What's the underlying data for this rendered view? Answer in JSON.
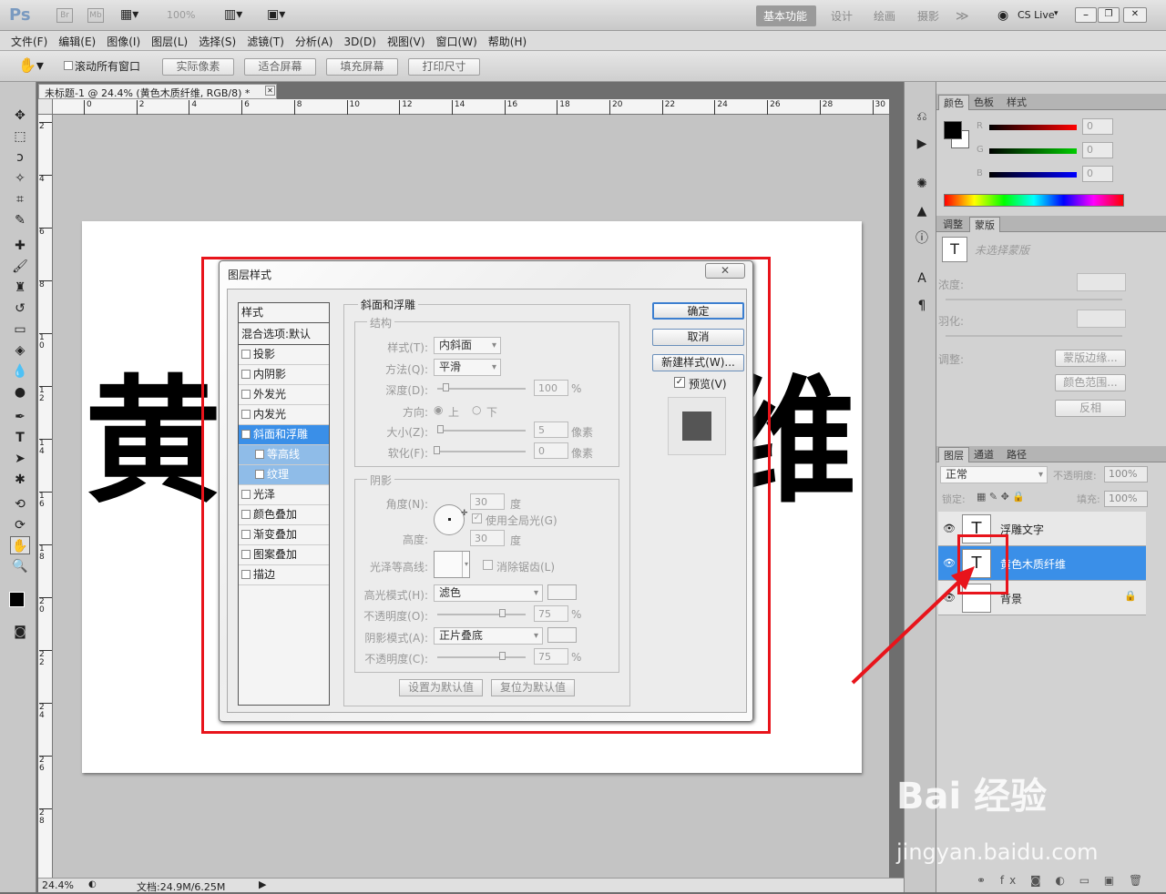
{
  "app": {
    "logo": "Ps",
    "br": "Br",
    "mb": "Mb",
    "zoom": "100%",
    "workspaces": [
      "基本功能",
      "设计",
      "绘画",
      "摄影"
    ],
    "cslive": "CS Live"
  },
  "menu": [
    "文件(F)",
    "编辑(E)",
    "图像(I)",
    "图层(L)",
    "选择(S)",
    "滤镜(T)",
    "分析(A)",
    "3D(D)",
    "视图(V)",
    "窗口(W)",
    "帮助(H)"
  ],
  "options": {
    "scroll_all": "滚动所有窗口",
    "actual_pixels": "实际像素",
    "fit_screen": "适合屏幕",
    "fill_screen": "填充屏幕",
    "print_size": "打印尺寸"
  },
  "document": {
    "tab_title": "未标题-1 @ 24.4% (黄色木质纤维, RGB/8) *",
    "ruler_h": [
      "0",
      "2",
      "4",
      "6",
      "8",
      "10",
      "12",
      "14",
      "16",
      "18",
      "20",
      "22",
      "24",
      "26",
      "28",
      "30"
    ],
    "ruler_v": [
      "2",
      "4",
      "6",
      "8",
      "1\n0",
      "1\n2",
      "1\n4",
      "1\n6",
      "1\n8",
      "2\n0",
      "2\n2",
      "2\n4",
      "2\n6",
      "2\n8"
    ],
    "char_left": "黄",
    "char_right": "维"
  },
  "status": {
    "zoom": "24.4%",
    "doc": "文档:24.9M/6.25M"
  },
  "color_panel": {
    "tabs": [
      "颜色",
      "色板",
      "样式"
    ],
    "r_label": "R",
    "g_label": "G",
    "b_label": "B",
    "r": "0",
    "g": "0",
    "b": "0"
  },
  "masks_panel": {
    "tabs": [
      "调整",
      "蒙版"
    ],
    "no_mask": "未选择蒙版",
    "density": "浓度:",
    "feather": "羽化:",
    "adjust": "调整:",
    "mask_edge": "蒙版边缘...",
    "color_range": "颜色范围...",
    "invert": "反相"
  },
  "layers_panel": {
    "tabs": [
      "图层",
      "通道",
      "路径"
    ],
    "blend_mode": "正常",
    "opacity_label": "不透明度:",
    "opacity": "100%",
    "lock_label": "锁定:",
    "fill_label": "填充:",
    "fill": "100%",
    "layers": [
      {
        "name": "浮雕文字",
        "thumb": "T"
      },
      {
        "name": "黄色木质纤维",
        "thumb": "T"
      },
      {
        "name": "背景",
        "thumb": ""
      }
    ]
  },
  "dialog": {
    "title": "图层样式",
    "close": "✕",
    "styles_header": "样式",
    "blend_options": "混合选项:默认",
    "styles": [
      "投影",
      "内阴影",
      "外发光",
      "内发光",
      "斜面和浮雕",
      "等高线",
      "纹理",
      "光泽",
      "颜色叠加",
      "渐变叠加",
      "图案叠加",
      "描边"
    ],
    "section_title": "斜面和浮雕",
    "structure": "结构",
    "style_label": "样式(T):",
    "style_value": "内斜面",
    "technique_label": "方法(Q):",
    "technique_value": "平滑",
    "depth_label": "深度(D):",
    "depth_value": "100",
    "pct": "%",
    "direction_label": "方向:",
    "dir_up": "上",
    "dir_down": "下",
    "size_label": "大小(Z):",
    "size_value": "5",
    "pixels": "像素",
    "soften_label": "软化(F):",
    "soften_value": "0",
    "shading": "阴影",
    "angle_label": "角度(N):",
    "angle_value": "30",
    "degree": "度",
    "global_light": "使用全局光(G)",
    "altitude_label": "高度:",
    "altitude_value": "30",
    "gloss_label": "光泽等高线:",
    "antialias": "消除锯齿(L)",
    "highlight_mode_label": "高光模式(H):",
    "highlight_mode": "滤色",
    "hl_opacity_label": "不透明度(O):",
    "hl_opacity": "75",
    "shadow_mode_label": "阴影模式(A):",
    "shadow_mode": "正片叠底",
    "sh_opacity_label": "不透明度(C):",
    "sh_opacity": "75",
    "make_default": "设置为默认值",
    "reset_default": "复位为默认值",
    "ok": "确定",
    "cancel": "取消",
    "new_style": "新建样式(W)...",
    "preview": "预览(V)"
  },
  "watermark": {
    "text": "Bai 经验",
    "url": "jingyan.baidu.com"
  },
  "colors": {
    "annotation": "#e8141b",
    "selection": "#3a8fe8"
  }
}
